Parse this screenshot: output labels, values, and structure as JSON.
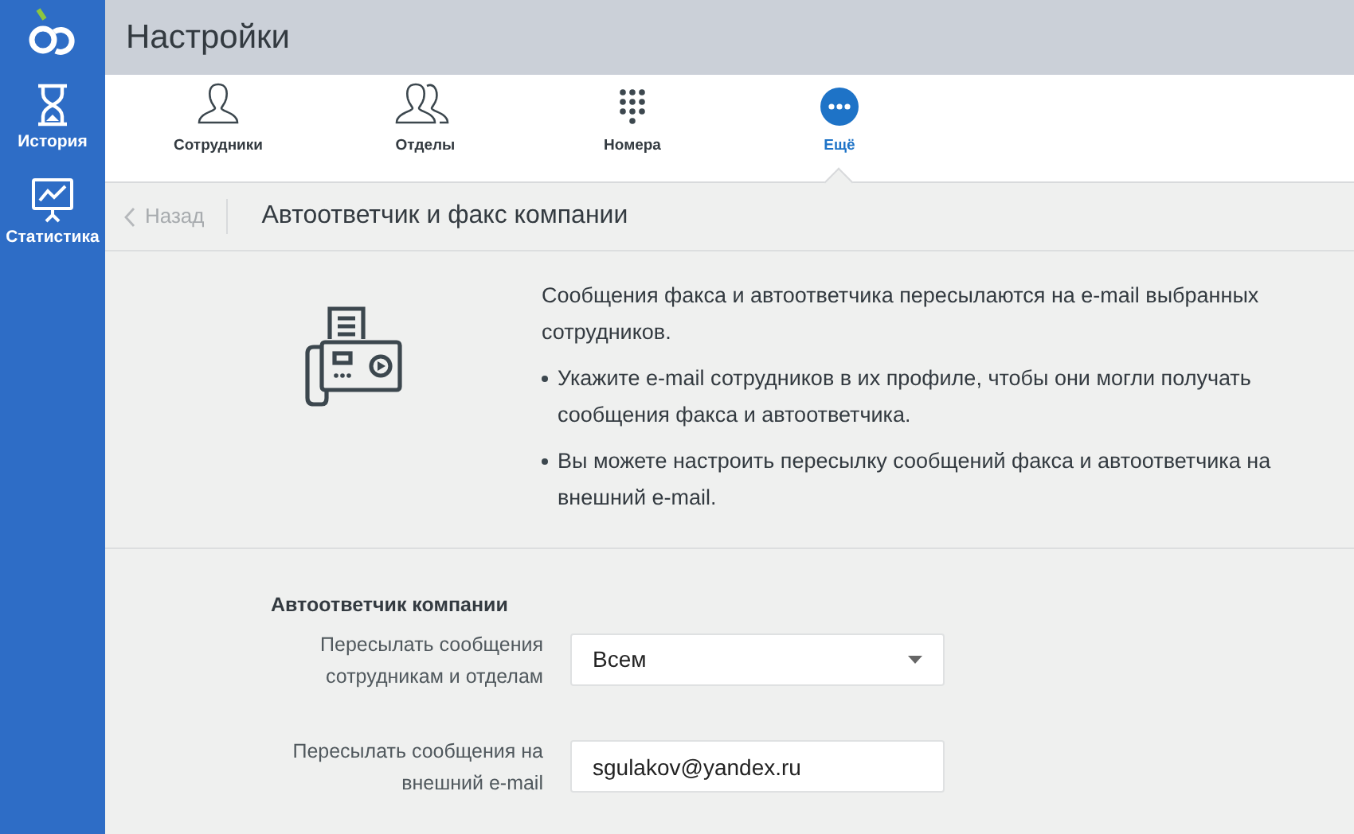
{
  "sidebar": {
    "items": [
      {
        "kind": "history",
        "label": "История"
      },
      {
        "kind": "stats",
        "label": "Статистика"
      }
    ]
  },
  "header": {
    "title": "Настройки"
  },
  "tabs": [
    {
      "kind": "person",
      "label": "Сотрудники",
      "selected": false
    },
    {
      "kind": "people",
      "label": "Отделы",
      "selected": false
    },
    {
      "kind": "keypad",
      "label": "Номера",
      "selected": false
    },
    {
      "kind": "more",
      "label": "Ещё",
      "selected": true
    }
  ],
  "subheader": {
    "back": "Назад",
    "title": "Автоответчик и факс компании"
  },
  "info": {
    "text": "Сообщения факса и автоответчика пересылаются на e-mail выбранных сотрудников.",
    "bullets": [
      "Укажите e-mail сотрудников в их профиле, чтобы они могли получать сообщения факса и автоответчика.",
      "Вы можете настроить пересылку сообщений факса и автоответчика на внешний e-mail."
    ]
  },
  "form": {
    "title": "Автоответчик компании",
    "fields": [
      {
        "kind": "select",
        "label": "Пересылать сообщения сотрудникам и отделам",
        "value": "Всем"
      },
      {
        "kind": "input",
        "label": "Пересылать сообщения на внешний e-mail",
        "value": "sgulakov@yandex.ru"
      }
    ]
  }
}
